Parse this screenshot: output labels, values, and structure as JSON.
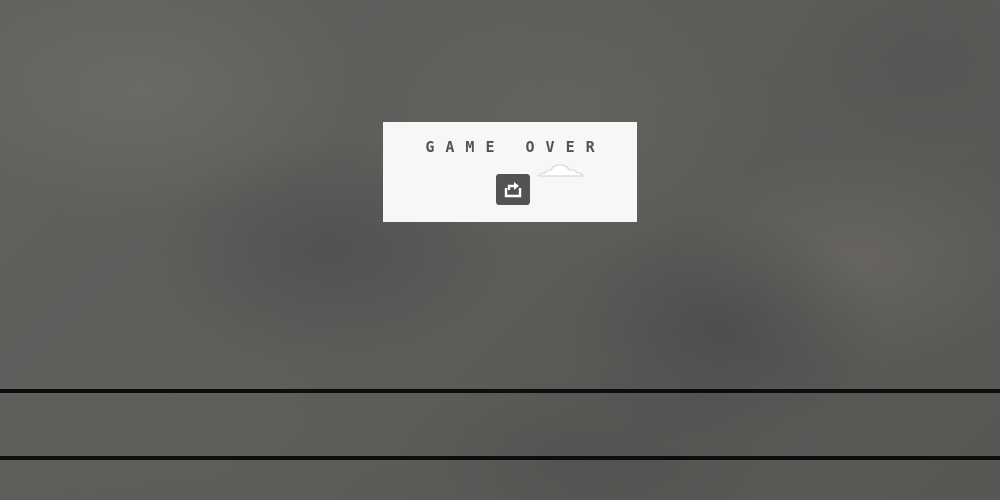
{
  "game": {
    "status_text": "GAME OVER"
  },
  "icons": {
    "restart": "restart-icon",
    "cloud": "cloud-icon"
  },
  "colors": {
    "panel": "#f7f7f7",
    "ink": "#535353",
    "ground": "#0d0d0d",
    "backdrop": "#5d5c59"
  }
}
